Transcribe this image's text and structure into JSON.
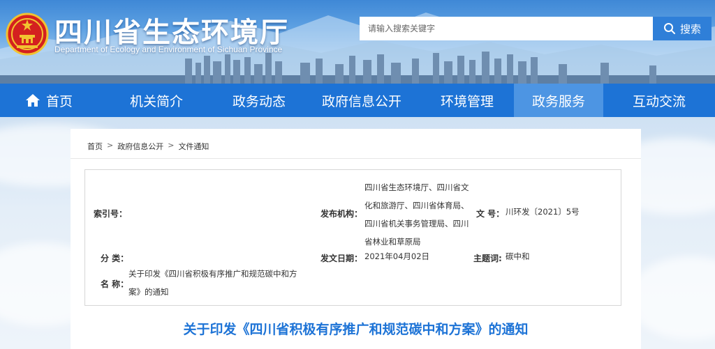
{
  "header": {
    "title": "四川省生态环境厅",
    "subtitle": "Department of Ecology and Environment of Sichuan Province",
    "search_placeholder": "请输入搜索关键字",
    "search_button": "搜索"
  },
  "nav": {
    "items": [
      {
        "label": "首页",
        "icon": "home-icon"
      },
      {
        "label": "机关简介"
      },
      {
        "label": "政务动态"
      },
      {
        "label": "政府信息公开"
      },
      {
        "label": "环境管理"
      },
      {
        "label": "政务服务",
        "active": true
      },
      {
        "label": "互动交流"
      }
    ]
  },
  "breadcrumb": {
    "items": [
      "首页",
      "政府信息公开",
      "文件通知"
    ],
    "separator": ">"
  },
  "meta": {
    "index_label": "索引号：",
    "index_value": "",
    "publisher_label": "发布机构：",
    "publisher_value": "四川省生态环境厅、四川省文化和旅游厅、四川省体育局、四川省机关事务管理局、四川省林业和草原局",
    "docno_label": "文 号：",
    "docno_value": "川环发〔2021〕5号",
    "category_label": "分 类：",
    "category_value": "",
    "date_label": "发文日期：",
    "date_value": "2021年04月02日",
    "topic_label": "主题词:",
    "topic_value": "碳中和",
    "name_label": "名 称：",
    "name_value": "关于印发《四川省积极有序推广和规范碳中和方案》的通知"
  },
  "document": {
    "title": "关于印发《四川省积极有序推广和规范碳中和方案》的通知"
  },
  "colors": {
    "nav_bg": "#1d73d6",
    "nav_active": "#4d95e3",
    "title_blue": "#1d73d6",
    "search_button": "#2f7fd8"
  }
}
